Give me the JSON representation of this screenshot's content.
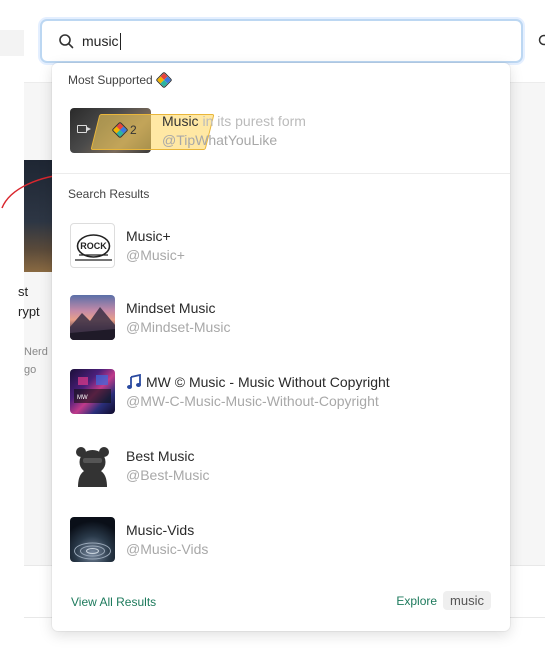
{
  "search": {
    "value": "music"
  },
  "most_supported": {
    "label": "Most Supported",
    "item": {
      "title_highlight": "Music",
      "title_rest": " in its purest form",
      "handle": "@TipWhatYouLike",
      "support_count": "2"
    }
  },
  "results": {
    "label": "Search Results",
    "items": [
      {
        "name": "Music+",
        "handle": "@Music+",
        "avatar_icon": "rock-logo-icon",
        "has_note_icon": false
      },
      {
        "name": "Mindset Music",
        "handle": "@Mindset-Music",
        "avatar_icon": "mountain-sunset-image",
        "has_note_icon": false
      },
      {
        "name": "MW © Music - Music Without Copyright",
        "handle": "@MW-C-Music-Music-Without-Copyright",
        "avatar_icon": "neon-studio-image",
        "has_note_icon": true
      },
      {
        "name": "Best Music",
        "handle": "@Best-Music",
        "avatar_icon": "bear-silhouette-icon",
        "has_note_icon": false
      },
      {
        "name": "Music-Vids",
        "handle": "@Music-Vids",
        "avatar_icon": "tunnel-image",
        "has_note_icon": false
      }
    ]
  },
  "footer": {
    "view_all": "View All Results",
    "explore": "Explore",
    "explore_tag": "music"
  },
  "background": {
    "text_line1": "st",
    "text_line2": "rypt",
    "text_line3": "Nerd",
    "text_line4": "go"
  },
  "colors": {
    "accent_green": "#1d7a5c",
    "search_border": "#bcd7f2",
    "highlight": "#f7d66a"
  }
}
